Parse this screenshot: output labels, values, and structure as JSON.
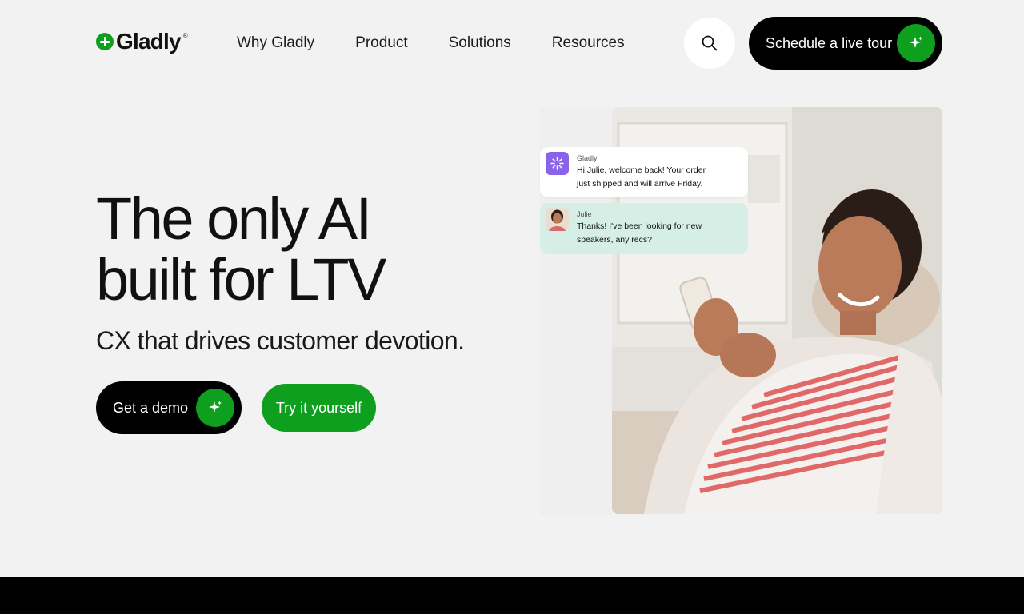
{
  "brand": {
    "name": "Gladly",
    "mark": "®"
  },
  "nav": {
    "items": [
      {
        "label": "Why Gladly"
      },
      {
        "label": "Product"
      },
      {
        "label": "Solutions"
      },
      {
        "label": "Resources"
      }
    ]
  },
  "header": {
    "search_icon": "search-icon",
    "cta_label": "Schedule a live tour"
  },
  "hero": {
    "title_line1": "The only AI",
    "title_line2": "built for LTV",
    "subtitle": "CX that drives customer devotion.",
    "primary_cta": "Get a demo",
    "secondary_cta": "Try it yourself"
  },
  "chat": {
    "messages": [
      {
        "sender": "Gladly",
        "line1": "Hi Julie, welcome back! Your order",
        "line2": "just shipped and will arrive Friday."
      },
      {
        "sender": "Julie",
        "line1": "Thanks! I've been looking for new",
        "line2": "speakers, any recs?"
      }
    ]
  },
  "colors": {
    "accent": "#0e9f1f",
    "dark": "#000000",
    "background": "#f2f2f2",
    "bubble_reply": "#d5efe6",
    "gladly_avatar": "#8a63e8"
  }
}
